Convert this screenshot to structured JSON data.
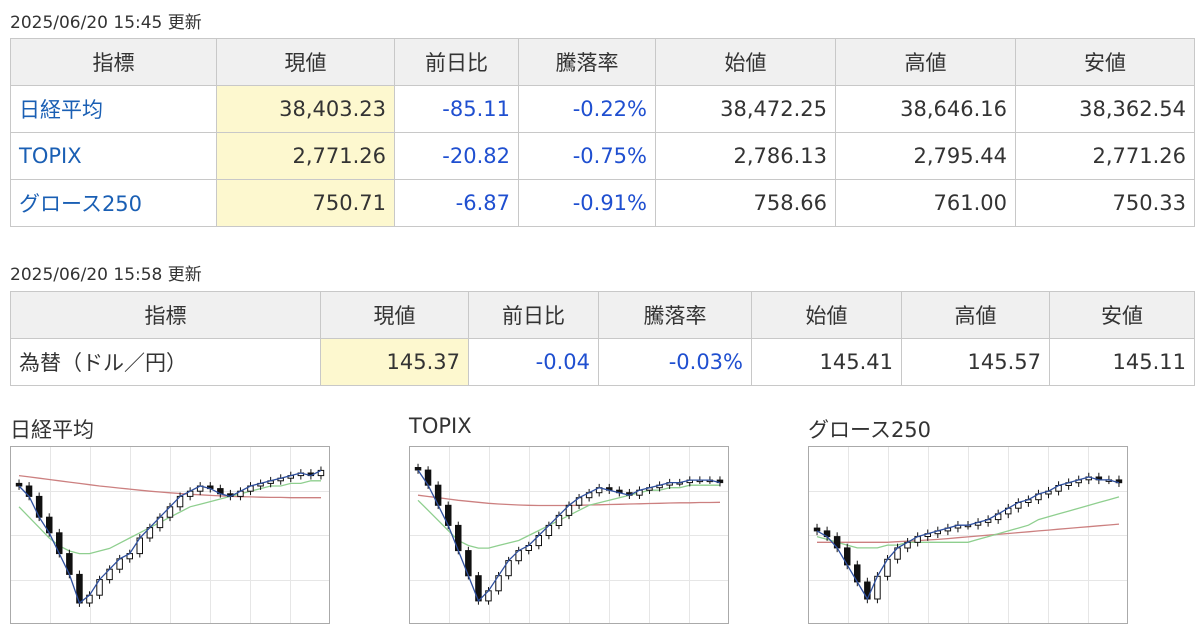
{
  "indices": {
    "updated": "2025/06/20 15:45 更新",
    "headers": [
      "指標",
      "現値",
      "前日比",
      "騰落率",
      "始値",
      "高値",
      "安値"
    ],
    "rows": [
      {
        "name": "日経平均",
        "current": "38,403.23",
        "change": "-85.11",
        "change_pct": "-0.22%",
        "open": "38,472.25",
        "high": "38,646.16",
        "low": "38,362.54"
      },
      {
        "name": "TOPIX",
        "current": "2,771.26",
        "change": "-20.82",
        "change_pct": "-0.75%",
        "open": "2,786.13",
        "high": "2,795.44",
        "low": "2,771.26"
      },
      {
        "name": "グロース250",
        "current": "750.71",
        "change": "-6.87",
        "change_pct": "-0.91%",
        "open": "758.66",
        "high": "761.00",
        "low": "750.33"
      }
    ]
  },
  "fx": {
    "updated": "2025/06/20 15:58 更新",
    "headers": [
      "指標",
      "現値",
      "前日比",
      "騰落率",
      "始値",
      "高値",
      "安値"
    ],
    "rows": [
      {
        "name": "為替（ドル／円）",
        "current": "145.37",
        "change": "-0.04",
        "change_pct": "-0.03%",
        "open": "145.41",
        "high": "145.57",
        "low": "145.11"
      }
    ]
  },
  "colors": {
    "link": "#1a5fb4",
    "change_negative": "#1f4fd0",
    "current_highlight": "#fdf8cf",
    "header_bg": "#f0f0f0",
    "ma_short": "#2e4f9e",
    "ma_mid": "#8fcf8f",
    "ma_long": "#cc8080"
  },
  "chart_data": [
    {
      "type": "candlestick",
      "title": "日経平均",
      "close": [
        100,
        96,
        88,
        82,
        74,
        66,
        55,
        58,
        64,
        68,
        72,
        74,
        80,
        84,
        88,
        92,
        96,
        98,
        100,
        99,
        97,
        96,
        98,
        100,
        101,
        102,
        103,
        104,
        105,
        104,
        106
      ],
      "ma_mid": [
        92,
        88,
        84,
        80,
        77,
        75,
        74,
        74,
        75,
        76,
        78,
        80,
        82,
        84,
        86,
        88,
        90,
        92,
        93,
        94,
        95,
        96,
        97,
        98,
        99,
        100,
        100,
        101,
        101,
        102,
        102
      ],
      "ma_long": [
        104,
        103.5,
        103,
        102.5,
        102,
        101.5,
        101,
        100.5,
        100,
        99.6,
        99.2,
        98.8,
        98.4,
        98,
        97.7,
        97.4,
        97.1,
        96.8,
        96.6,
        96.4,
        96.2,
        96,
        95.9,
        95.8,
        95.7,
        95.6,
        95.6,
        95.5,
        95.5,
        95.5,
        95.5
      ],
      "ylim": [
        50,
        110
      ]
    },
    {
      "type": "candlestick",
      "title": "TOPIX",
      "close": [
        108,
        102,
        94,
        86,
        76,
        66,
        56,
        60,
        66,
        72,
        76,
        78,
        82,
        86,
        90,
        94,
        97,
        99,
        101,
        100,
        99,
        98,
        100,
        101,
        102,
        103,
        103,
        104,
        104,
        104,
        103
      ],
      "ma_mid": [
        96,
        92,
        88,
        84,
        80,
        78,
        77,
        77,
        78,
        79,
        80,
        82,
        84,
        86,
        88,
        90,
        92,
        94,
        95,
        96,
        97,
        98,
        99,
        100,
        100,
        101,
        101,
        102,
        102,
        102,
        102
      ],
      "ma_long": [
        98,
        97.5,
        97,
        96.5,
        96,
        95.6,
        95.2,
        94.8,
        94.5,
        94.3,
        94.1,
        94,
        93.9,
        93.9,
        93.9,
        93.9,
        94,
        94.1,
        94.2,
        94.3,
        94.4,
        94.5,
        94.6,
        94.7,
        94.8,
        94.9,
        95,
        95,
        95.1,
        95.1,
        95.2
      ],
      "ylim": [
        50,
        112
      ]
    },
    {
      "type": "candlestick",
      "title": "グロース250",
      "close": [
        90,
        88,
        84,
        78,
        72,
        66,
        74,
        80,
        84,
        86,
        88,
        89,
        90,
        91,
        92,
        92,
        93,
        94,
        96,
        98,
        100,
        101,
        103,
        104,
        106,
        107,
        108,
        109,
        108,
        108,
        107
      ],
      "ma_mid": [
        88,
        87,
        86,
        85,
        84,
        84,
        84,
        85,
        85,
        86,
        86,
        86,
        86,
        86,
        86,
        86,
        87,
        88,
        89,
        90,
        91,
        92,
        94,
        95,
        96,
        97,
        98,
        99,
        100,
        101,
        102
      ],
      "ma_long": [
        86,
        86,
        86,
        86,
        86,
        86,
        86,
        86,
        86.2,
        86.4,
        86.6,
        86.8,
        87,
        87.3,
        87.6,
        87.9,
        88.2,
        88.5,
        88.8,
        89.1,
        89.4,
        89.7,
        90,
        90.3,
        90.6,
        90.9,
        91.2,
        91.5,
        91.8,
        92.1,
        92.4
      ],
      "ylim": [
        60,
        115
      ]
    }
  ]
}
